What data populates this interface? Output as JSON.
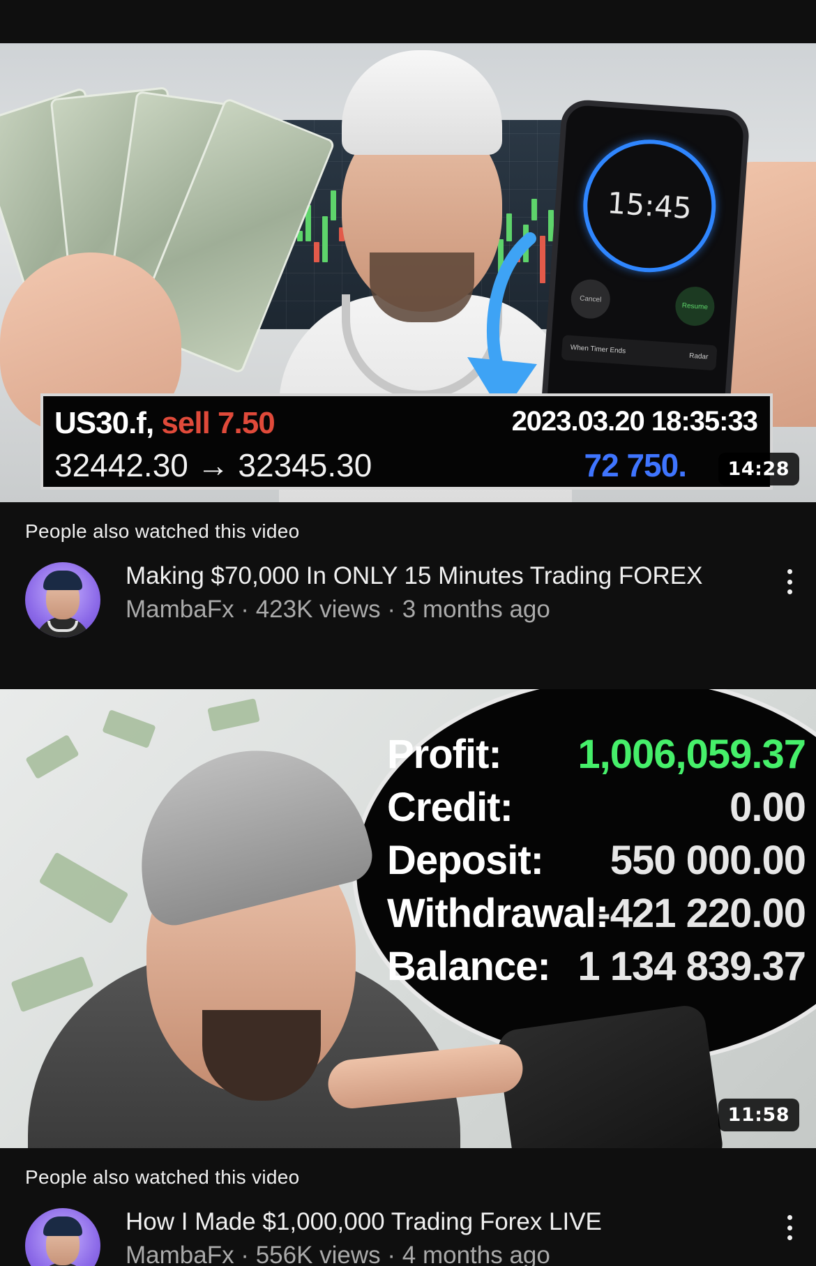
{
  "videos": [
    {
      "duration": "14:28",
      "thumbnail": {
        "symbol": "US30.f,",
        "side": "sell 7.50",
        "datetime": "2023.03.20 18:35:33",
        "prices": "32442.30 → 32345.30",
        "profit": "72 750.",
        "phone_timer": "15:45",
        "phone_cancel": "Cancel",
        "phone_resume": "Resume",
        "phone_row_label": "When Timer Ends",
        "phone_row_value": "Radar"
      },
      "context_label": "People also watched this video",
      "title": "Making $70,000 In ONLY 15 Minutes Trading FOREX",
      "meta": "MambaFx · 423K views · 3 months ago"
    },
    {
      "duration": "11:58",
      "thumbnail": {
        "stats": [
          {
            "label": "Profit:",
            "value": "1,006,059.37"
          },
          {
            "label": "Credit:",
            "value": "0.00"
          },
          {
            "label": "Deposit:",
            "value": "550 000.00"
          },
          {
            "label": "Withdrawal:",
            "value": "-421 220.00"
          },
          {
            "label": "Balance:",
            "value": "1 134 839.37"
          }
        ]
      },
      "context_label": "People also watched this video",
      "title": "How I Made $1,000,000 Trading Forex LIVE",
      "meta": "MambaFx · 556K views · 4 months ago"
    }
  ],
  "colors": {
    "background": "#0f0f0f",
    "text_primary": "#f1f1f1",
    "text_secondary": "#aaaaaa",
    "sell_red": "#e04a3a",
    "profit_blue": "#3f75ff",
    "profit_green": "#46f06a",
    "timer_ring": "#2f86ff"
  },
  "icons": [
    "more-vert-icon",
    "channel-avatar"
  ]
}
